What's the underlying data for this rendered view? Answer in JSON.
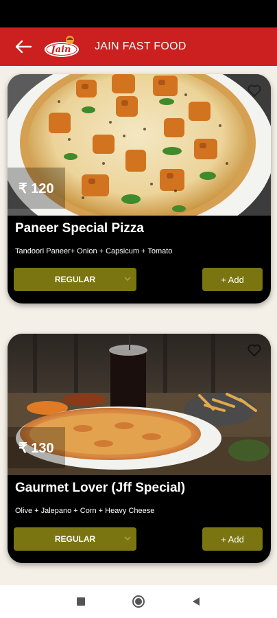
{
  "header": {
    "title": "JAIN FAST FOOD",
    "logo_text": "Jain",
    "colors": {
      "header_bg": "#cc1f1f",
      "accent_olive": "#7a7510"
    }
  },
  "items": [
    {
      "name": "Paneer Special Pizza",
      "description": "Tandoori Paneer+ Onion + Capsicum + Tomato",
      "price": "₹ 120",
      "variant": "REGULAR",
      "add_label": "+ Add"
    },
    {
      "name": "Gaurmet Lover (Jff Special)",
      "description": "Olive + Jalepano + Corn + Heavy Cheese",
      "price": "₹ 130",
      "variant": "REGULAR",
      "add_label": "+ Add"
    }
  ],
  "icons": {
    "back": "arrow-left-icon",
    "favorite": "heart-outline-icon",
    "dropdown": "chevron-down-icon",
    "nav_recent": "square-icon",
    "nav_home": "circle-icon",
    "nav_back": "triangle-left-icon"
  }
}
